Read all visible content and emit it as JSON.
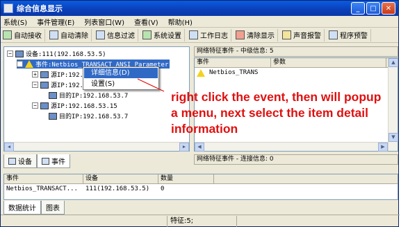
{
  "window": {
    "title": "综合信息显示",
    "min": "_",
    "max": "□",
    "close": "✕"
  },
  "menu": [
    "系统(S)",
    "事件管理(E)",
    "列表窗口(W)",
    "查看(V)",
    "帮助(H)"
  ],
  "toolbar": [
    "自动接收",
    "自动清除",
    "信息过滤",
    "系统设置",
    "工作日志",
    "清除显示",
    "声音报警",
    "程序预警"
  ],
  "tree": {
    "device": "设备:111(192.168.53.5)",
    "event": "事件:Netbios_TRANSACT_ANSI_Parameter",
    "src1": "源IP:192.168.53.5",
    "src2": "源IP:192.168.53.7",
    "dst1": "目的IP:192.168.53.7",
    "src3": "源IP:192.168.53.15",
    "dst2": "目的IP:192.168.53.7",
    "plus": "+",
    "minus": "−"
  },
  "context_menu": {
    "detail": "详细信息(D)",
    "settings": "设置(S)"
  },
  "left_tabs": [
    "设备",
    "事件"
  ],
  "right_top": {
    "header": "网络特征事件 - 中级信息: 5",
    "columns": [
      "事件",
      "参数"
    ],
    "row_event": "Netbios_TRANS"
  },
  "right_bottom": {
    "header": "网络特征事件 - 连接信息: 0"
  },
  "bottom_grid": {
    "columns": [
      "事件",
      "设备",
      "数量"
    ],
    "row": {
      "event": "Netbios_TRANSACT...",
      "device": "111(192.168.53.5)",
      "count": "0"
    }
  },
  "bottom_tabs": [
    "数据统计",
    "图表"
  ],
  "status": {
    "features": "特征:5;"
  },
  "annotation": [
    "right click the event, then will popup",
    "a menu, next select the item detail",
    "information"
  ],
  "colors": {
    "annotation": "#e01010",
    "titlebar": "#0b3fb8",
    "selection": "#316ac5"
  }
}
